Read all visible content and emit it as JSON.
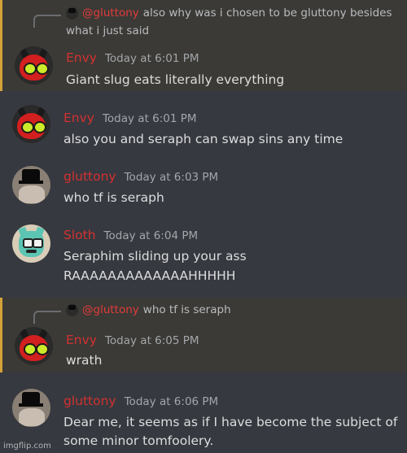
{
  "messages": [
    {
      "reply": {
        "name": "@gluttony",
        "text": "also why was i chosen to be gluttony besides"
      },
      "reply_cont": "what i just said",
      "author": "Envy",
      "time": "Today at 6:01 PM",
      "lines": [
        "Giant slug eats literally everything"
      ],
      "avatar": "envy-avatar",
      "highlight": true
    },
    {
      "author": "Envy",
      "time": "Today at 6:01 PM",
      "lines": [
        "also you and seraph can swap sins any time"
      ],
      "avatar": "envy-avatar"
    },
    {
      "author": "gluttony",
      "time": "Today at 6:03 PM",
      "lines": [
        "who tf is seraph"
      ],
      "avatar": "gluttony-avatar"
    },
    {
      "author": "Sloth",
      "time": "Today at 6:04 PM",
      "lines": [
        "Seraphim sliding up your ass",
        "RAAAAAAAAAAAAAHHHHH"
      ],
      "avatar": "sloth-avatar"
    },
    {
      "reply": {
        "name": "@gluttony",
        "text": "who tf is seraph"
      },
      "author": "Envy",
      "time": "Today at 6:05 PM",
      "lines": [
        "wrath"
      ],
      "avatar": "envy-avatar",
      "highlight": true
    },
    {
      "author": "gluttony",
      "time": "Today at 6:06 PM",
      "lines": [
        "Dear me, it seems as if I have become the subject of",
        "some minor tomfoolery."
      ],
      "avatar": "gluttony-avatar"
    }
  ],
  "watermark": "imgflip.com",
  "colors": {
    "background": "#36393f",
    "mention_bg": "#3b3a36",
    "mention_bar": "#d3a23a",
    "username": "#d33131",
    "timestamp": "#a3a6aa",
    "text": "#dcddde"
  }
}
